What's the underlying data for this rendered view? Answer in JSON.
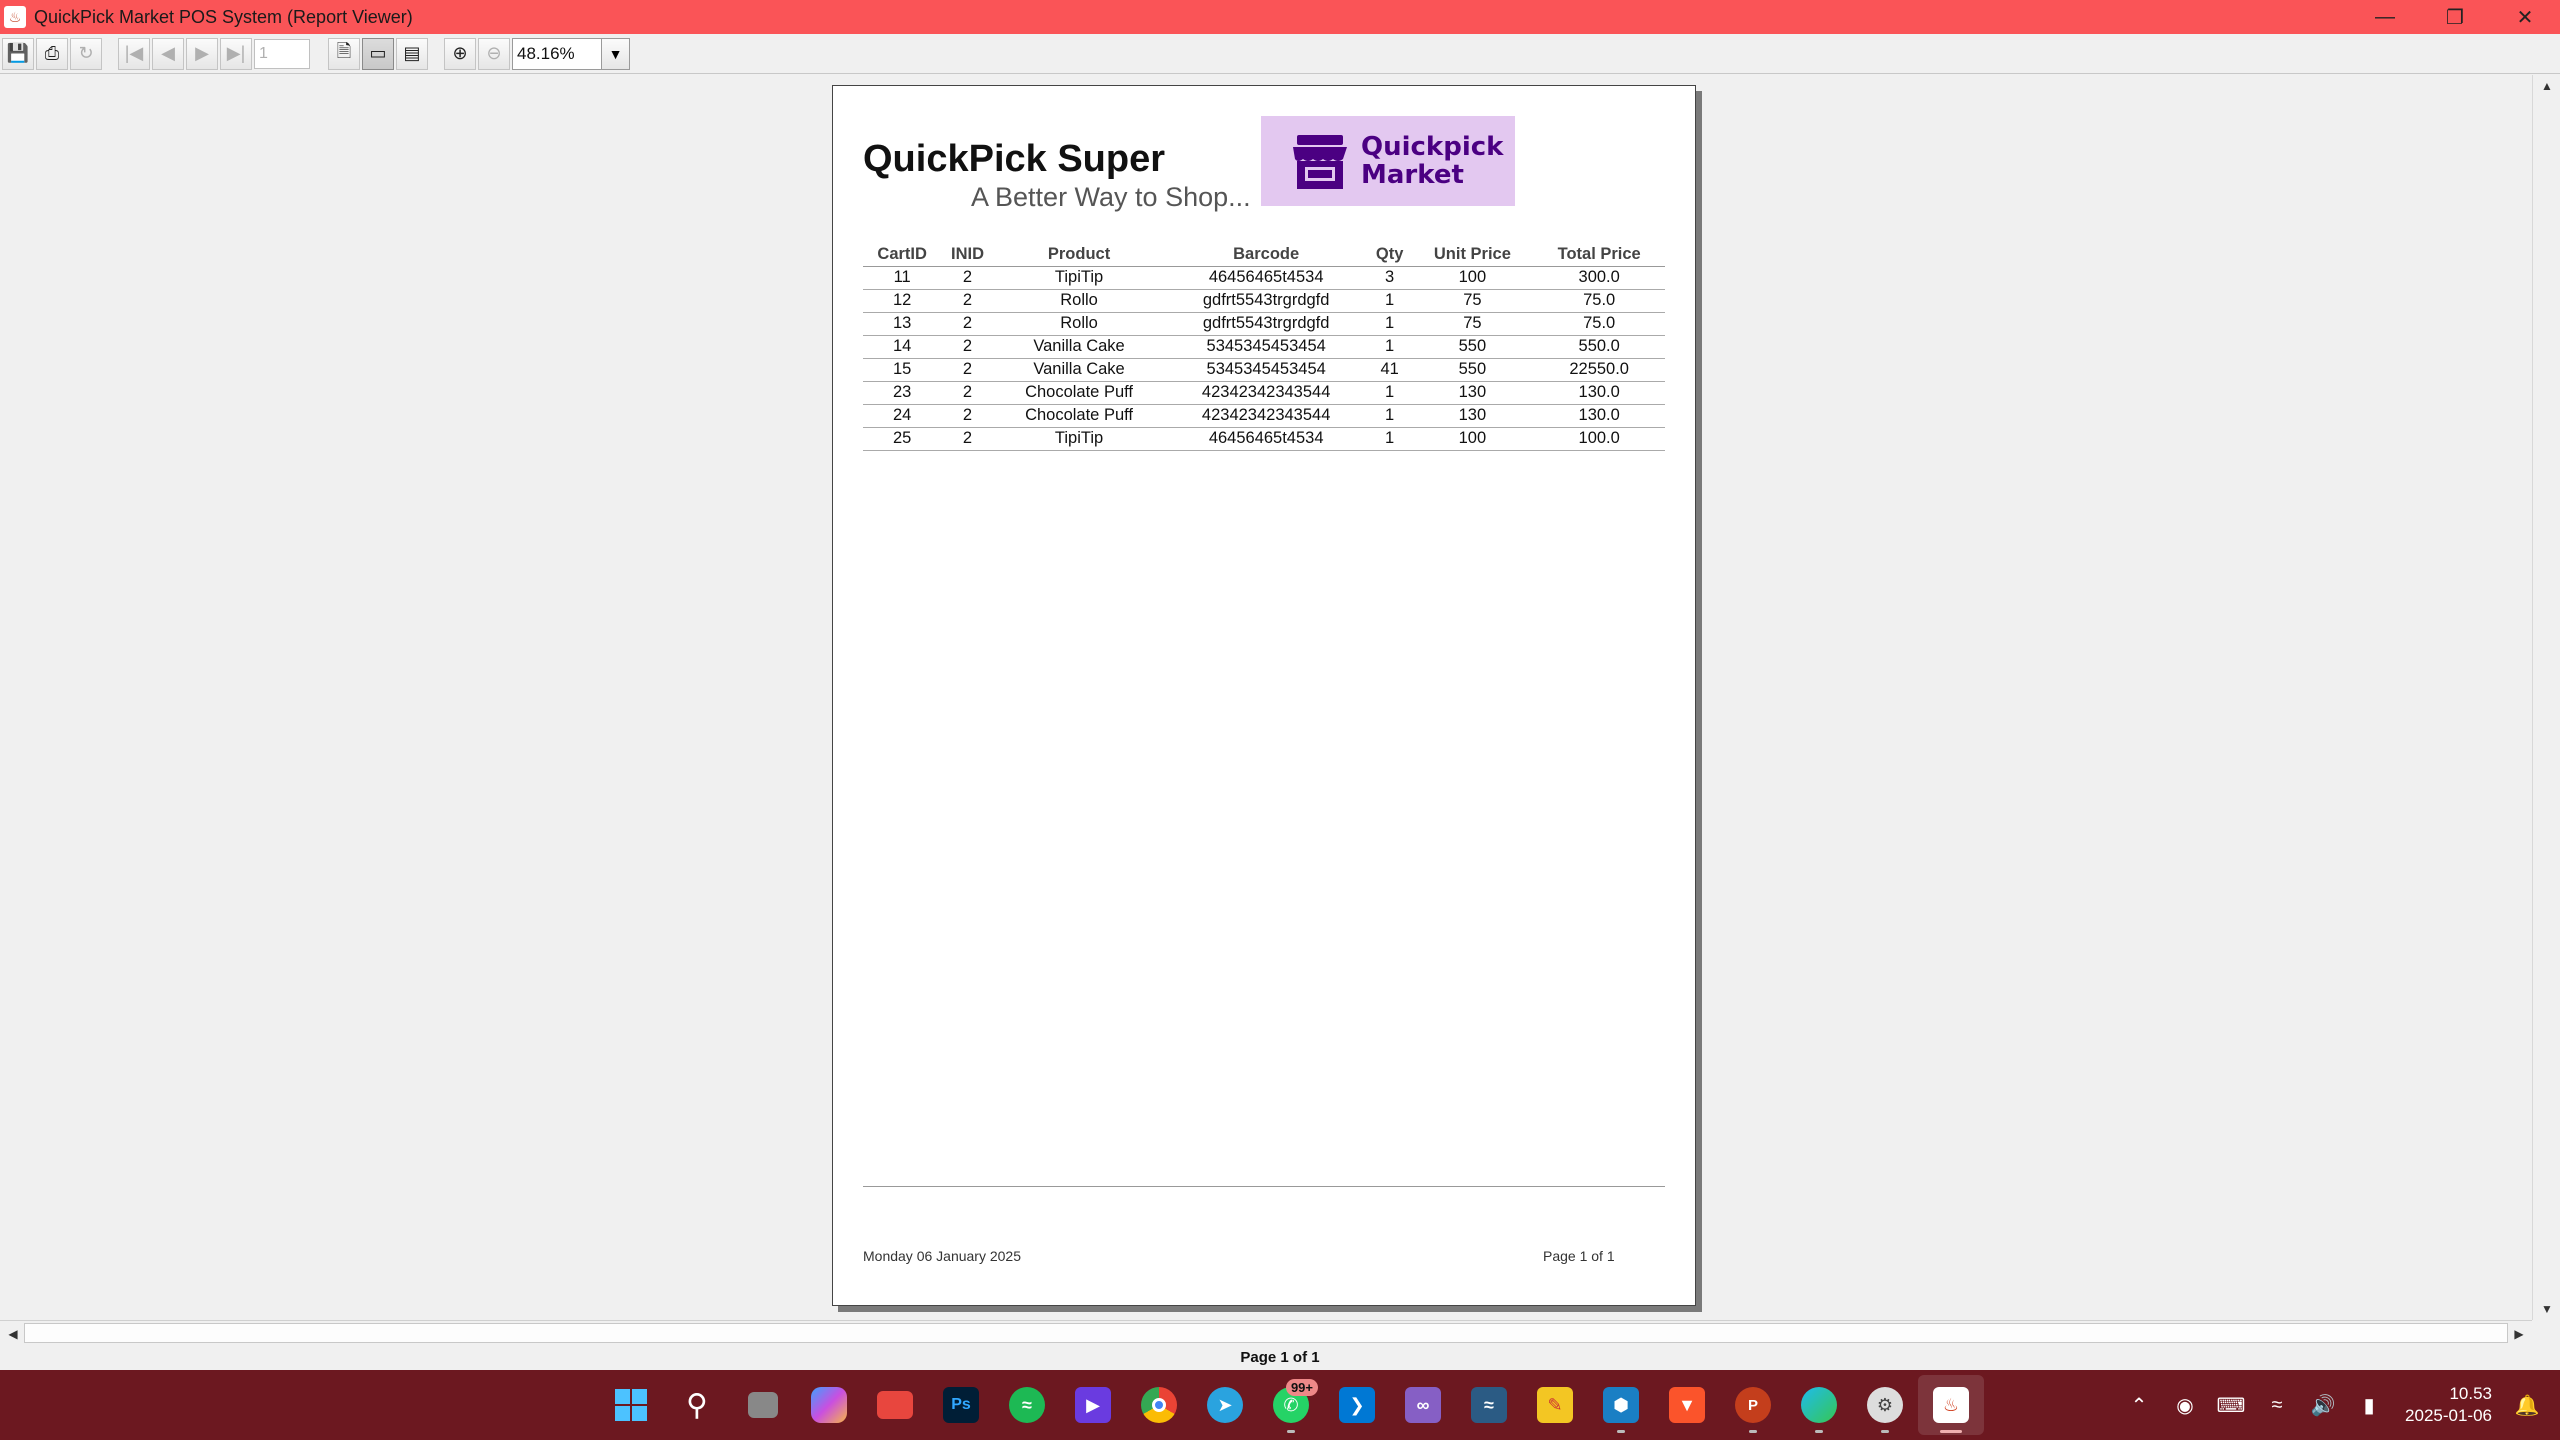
{
  "window": {
    "title": "QuickPick Market POS System (Report Viewer)",
    "controls": [
      "minimize",
      "restore",
      "close"
    ]
  },
  "toolbar": {
    "page_input": "1",
    "zoom": "48.16%",
    "buttons": [
      "save-icon",
      "print-icon",
      "reload-icon",
      "first-page-icon",
      "previous-page-icon",
      "next-page-icon",
      "last-page-icon",
      "actual-size-icon",
      "fit-page-icon",
      "fit-width-icon",
      "zoom-in-icon",
      "zoom-out-icon"
    ]
  },
  "report": {
    "company": "QuickPick Super",
    "tagline": "A Better Way to Shop...",
    "logo_text_line1": "Quickpick",
    "logo_text_line2": "Market",
    "columns": [
      "CartID",
      "INID",
      "Product",
      "Barcode",
      "Qty",
      "Unit Price",
      "Total Price"
    ],
    "rows": [
      [
        "11",
        "2",
        "TipiTip",
        "46456465t4534",
        "3",
        "100",
        "300.0"
      ],
      [
        "12",
        "2",
        "Rollo",
        "gdfrt5543trgrdgfd",
        "1",
        "75",
        "75.0"
      ],
      [
        "13",
        "2",
        "Rollo",
        "gdfrt5543trgrdgfd",
        "1",
        "75",
        "75.0"
      ],
      [
        "14",
        "2",
        "Vanilla Cake",
        "5345345453454",
        "1",
        "550",
        "550.0"
      ],
      [
        "15",
        "2",
        "Vanilla Cake",
        "5345345453454",
        "41",
        "550",
        "22550.0"
      ],
      [
        "23",
        "2",
        "Chocolate Puff",
        "42342342343544",
        "1",
        "130",
        "130.0"
      ],
      [
        "24",
        "2",
        "Chocolate Puff",
        "42342342343544",
        "1",
        "130",
        "130.0"
      ],
      [
        "25",
        "2",
        "TipiTip",
        "46456465t4534",
        "1",
        "100",
        "100.0"
      ]
    ],
    "footer_date": "Monday 06 January 2025",
    "footer_page": "Page 1 of 1"
  },
  "status": {
    "page_label": "Page 1 of 1"
  },
  "taskbar": {
    "whatsapp_badge": "99+",
    "clock_time": "10.53",
    "clock_date": "2025-01-06"
  },
  "colors": {
    "titlebar": "#fa5457",
    "taskbar": "#6c1820",
    "logo_bg": "#e3c8f0",
    "logo_fg": "#4b0082"
  }
}
